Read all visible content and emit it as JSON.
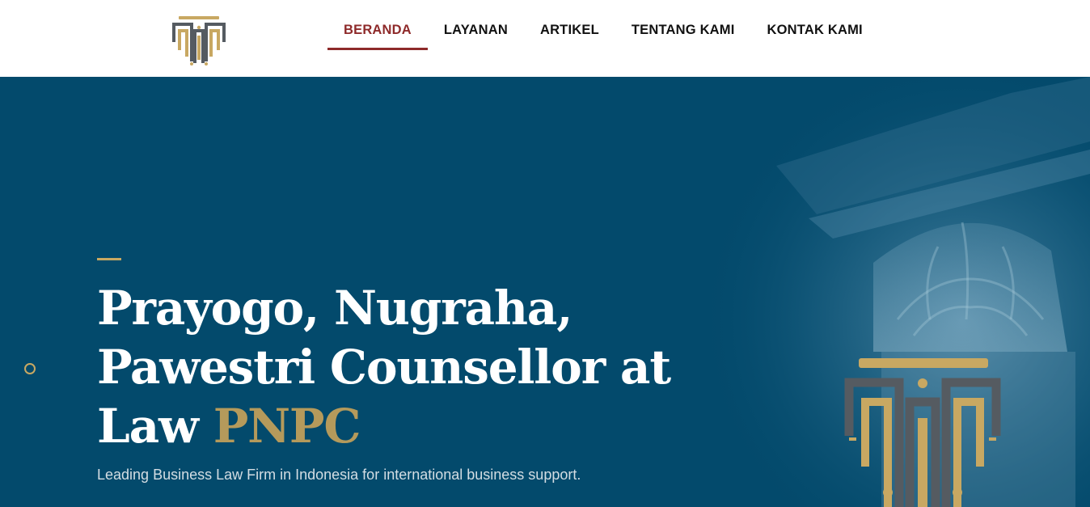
{
  "nav": {
    "items": [
      {
        "label": "BERANDA",
        "active": true
      },
      {
        "label": "LAYANAN",
        "active": false
      },
      {
        "label": "ARTIKEL",
        "active": false
      },
      {
        "label": "TENTANG KAMI",
        "active": false
      },
      {
        "label": "KONTAK KAMI",
        "active": false
      }
    ]
  },
  "hero": {
    "title_line1": "Prayogo, Nugraha,",
    "title_line2": "Pawestri Counsellor at",
    "title_line3": "Law ",
    "title_brand": "PNPC",
    "subtitle": "Leading Business Law Firm in Indonesia for international business support."
  },
  "colors": {
    "hero_bg": "#034a6c",
    "gold": "#c8a862",
    "active_nav": "#8e2a2a",
    "logo_gray": "#555b61"
  },
  "icons": {
    "logo": "pillar-logo-icon",
    "slider_indicator": "circle-icon"
  }
}
